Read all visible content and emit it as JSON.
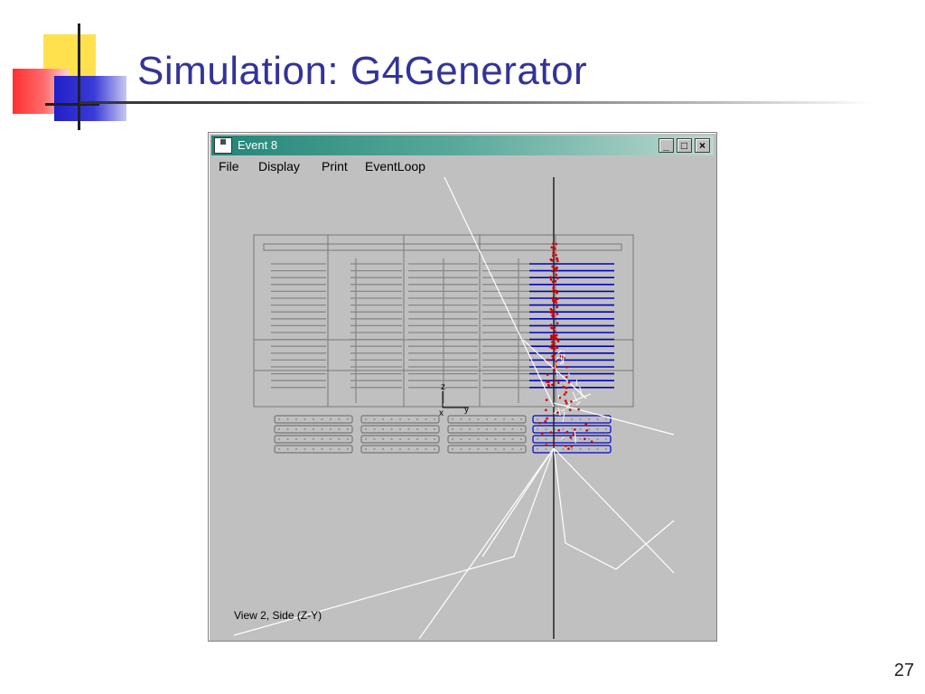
{
  "slide": {
    "title": "Simulation: G4Generator",
    "page_number": "27"
  },
  "window": {
    "title": "Event 8",
    "icon_label": "ICON",
    "buttons": {
      "minimize": "_",
      "maximize": "□",
      "close": "×"
    },
    "menu": [
      "File",
      "Display",
      "Print",
      "EventLoop"
    ]
  },
  "view": {
    "label": "View 2, Side (Z-Y)",
    "axis_z": "z",
    "axis_x": "x",
    "axis_y": "y"
  },
  "colors": {
    "title": "#333399",
    "titlebar": "#228577",
    "hits": "#0000cc",
    "tracks": "#cc0000"
  }
}
